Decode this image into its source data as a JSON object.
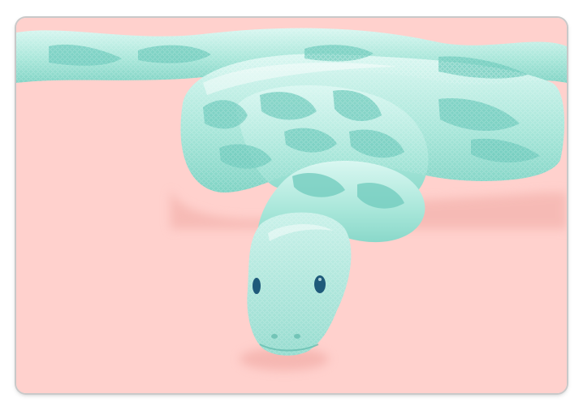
{
  "product": {
    "type": "laptop-skin",
    "artwork": "pastel-mint-snake-on-pink"
  },
  "colors": {
    "background_pink": "#ffd1cd",
    "snake_mint": "#9fe3d5",
    "snake_light": "#d6f5ef",
    "snake_pattern": "#6fcbbd",
    "snake_shadow": "#f3b7b2",
    "eye": "#1f5a7a",
    "frame_border": "#c9c9c9"
  }
}
